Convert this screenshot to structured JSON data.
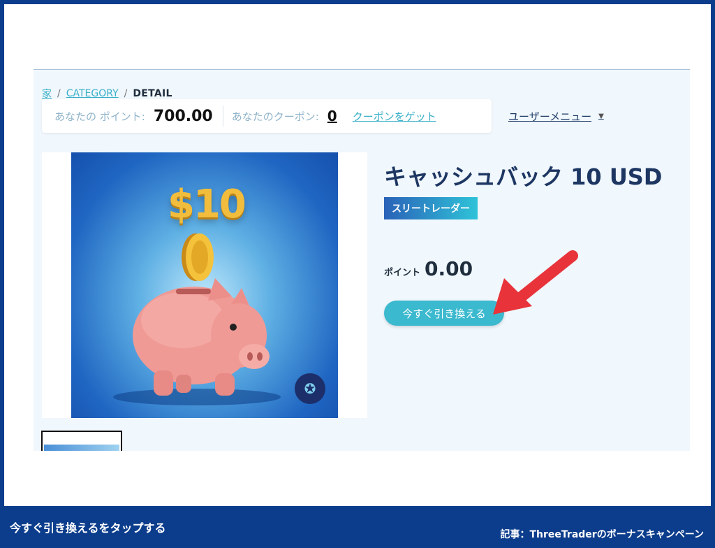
{
  "breadcrumb": {
    "home": "家",
    "category": "CATEGORY",
    "current": "DETAIL",
    "separator": "/"
  },
  "points_bar": {
    "points_label": "あなたの ポイント:",
    "points_value": "700.00",
    "coupons_label": "あなたのクーポン:",
    "coupons_value": "0",
    "get_coupon_link": "クーポンをゲット"
  },
  "user_menu": {
    "label": "ユーザーメニュー",
    "caret": "▼"
  },
  "product": {
    "image_price_text": "$10",
    "title": "キャッシュバック 10 USD",
    "brand_tag": "スリートレーダー",
    "points_label": "ポイント",
    "points_value": "0.00",
    "redeem_button": "今すぐ引き換える"
  },
  "captions": {
    "instruction": "今すぐ引き換えるをタップする",
    "article": "記事：ThreeTraderのボーナスキャンペーン"
  },
  "colors": {
    "accent": "#3bb9ce",
    "arrow": "#e8333a",
    "frame": "#0c3d8c",
    "title": "#1d3662"
  }
}
